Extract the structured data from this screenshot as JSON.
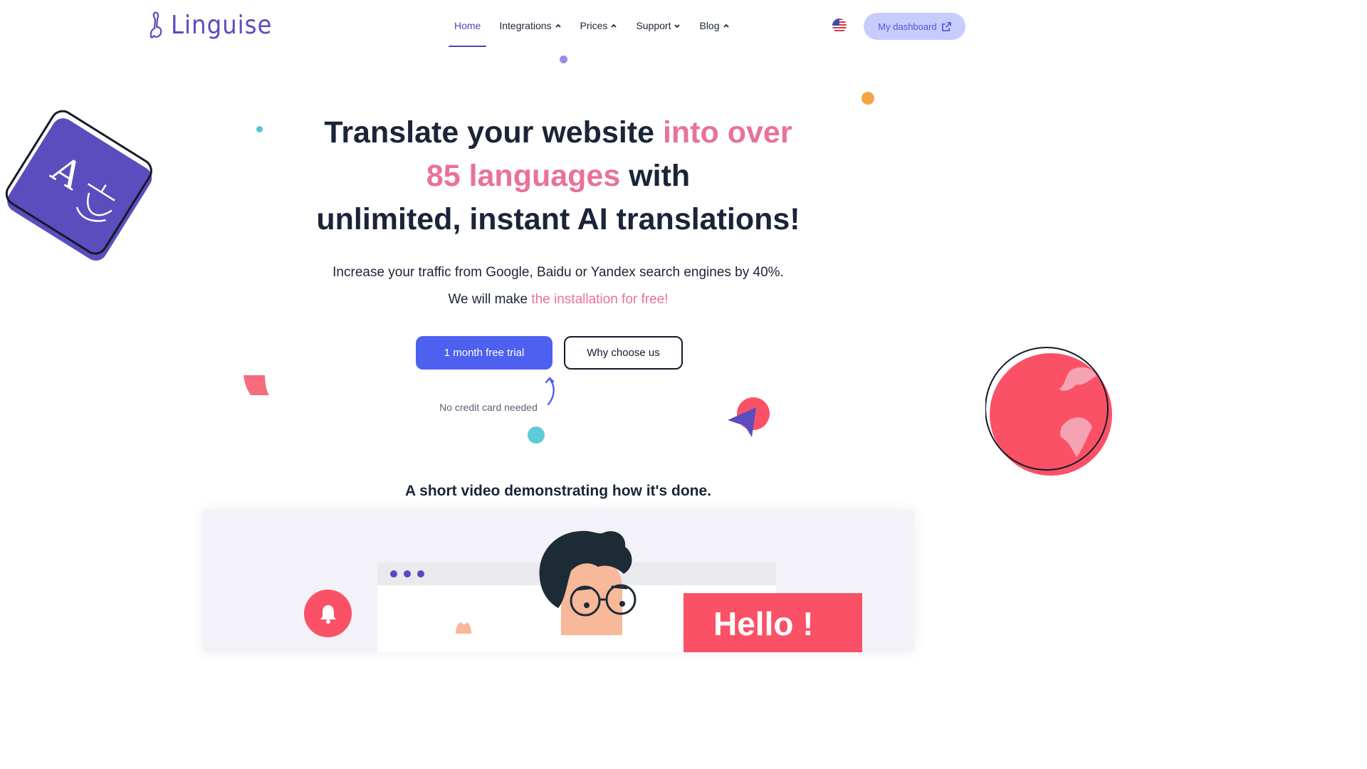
{
  "header": {
    "logo_text": "Linguise",
    "nav": [
      {
        "label": "Home",
        "active": true,
        "caret": ""
      },
      {
        "label": "Integrations",
        "active": false,
        "caret": "up"
      },
      {
        "label": "Prices",
        "active": false,
        "caret": "up"
      },
      {
        "label": "Support",
        "active": false,
        "caret": "down"
      },
      {
        "label": "Blog",
        "active": false,
        "caret": "up"
      }
    ],
    "language_flag": "us-flag-icon",
    "dashboard_button": "My dashboard"
  },
  "hero": {
    "title_1": "Translate your website ",
    "title_2": "into over",
    "title_3": "85 languages",
    "title_4": " with",
    "title_5": "unlimited, instant AI translations!",
    "subtitle": "Increase your traffic from Google, Baidu or Yandex search engines by 40%.",
    "install_prefix": "We will make ",
    "install_highlight": "the installation for free!",
    "primary_button": "1 month free trial",
    "secondary_button": "Why choose us",
    "note": "No credit card needed"
  },
  "video": {
    "title": "A short video demonstrating how it's done.",
    "hello_text": "Hello !"
  },
  "colors": {
    "brand": "#5b4dbd",
    "accent_pink": "#e8729b",
    "primary_button": "#4d60f0",
    "dashboard_bg": "#c7ccfd",
    "coral": "#fb5167"
  }
}
